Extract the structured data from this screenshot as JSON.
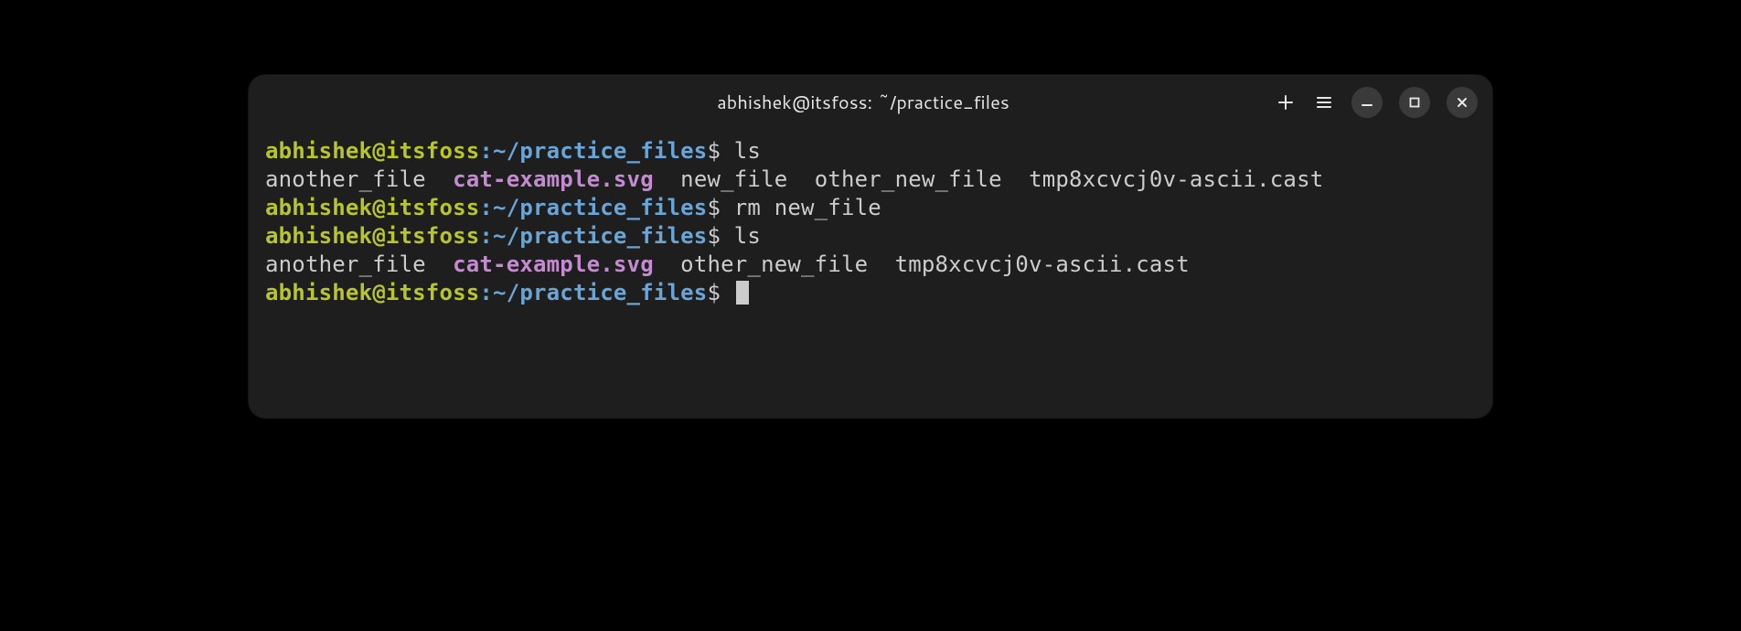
{
  "titlebar": {
    "title": "abhishek@itsfoss: ~/practice_files"
  },
  "prompt": {
    "userhost": "abhishek@itsfoss",
    "colon": ":",
    "path": "~/practice_files",
    "symbol": "$"
  },
  "lines": [
    {
      "type": "prompt",
      "command": "ls"
    },
    {
      "type": "output_files",
      "files": [
        {
          "name": "another_file",
          "style": "plain"
        },
        {
          "name": "cat-example.svg",
          "style": "highlight"
        },
        {
          "name": "new_file",
          "style": "plain"
        },
        {
          "name": "other_new_file",
          "style": "plain"
        },
        {
          "name": "tmp8xcvcj0v-ascii.cast",
          "style": "plain"
        }
      ]
    },
    {
      "type": "prompt",
      "command": "rm new_file"
    },
    {
      "type": "prompt",
      "command": "ls"
    },
    {
      "type": "output_files",
      "files": [
        {
          "name": "another_file",
          "style": "plain"
        },
        {
          "name": "cat-example.svg",
          "style": "highlight"
        },
        {
          "name": "other_new_file",
          "style": "plain"
        },
        {
          "name": "tmp8xcvcj0v-ascii.cast",
          "style": "plain"
        }
      ]
    },
    {
      "type": "prompt_cursor"
    }
  ]
}
